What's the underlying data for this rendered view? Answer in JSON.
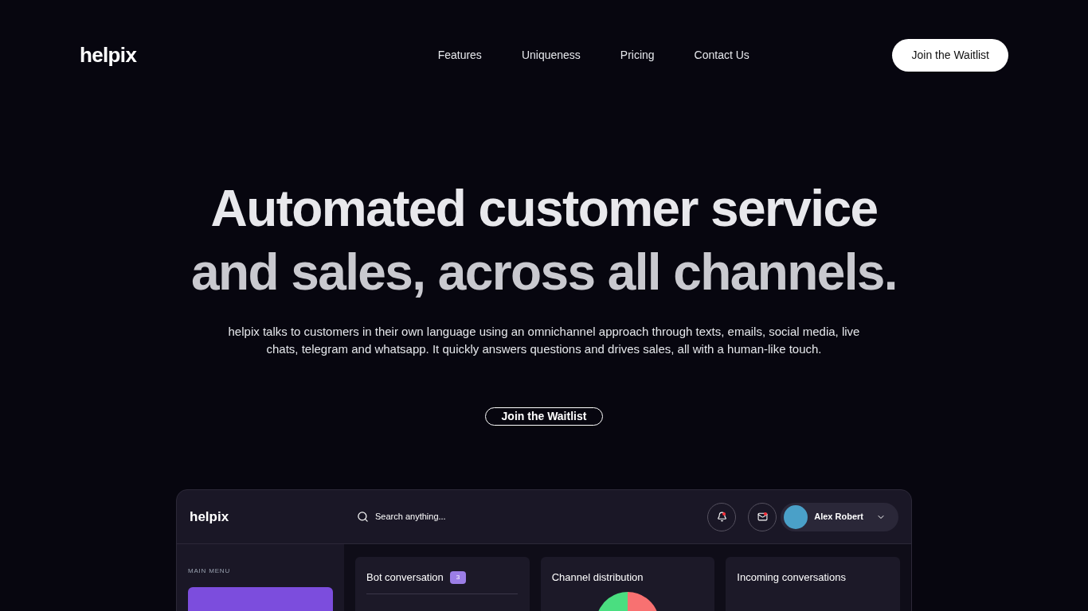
{
  "brand": "helpix",
  "nav": [
    {
      "label": "Features"
    },
    {
      "label": "Uniqueness"
    },
    {
      "label": "Pricing"
    },
    {
      "label": "Contact Us"
    }
  ],
  "nav_button": "Join the Waitlist",
  "hero": {
    "headline_lines": [
      "Automated customer service",
      "and sales, across all channels."
    ],
    "description": "helpix talks to customers in their own language using an omnichannel approach through texts, emails, social media, live chats, telegram and whatsapp. It quickly answers questions and drives sales, all with a human-like touch.",
    "button": "Join the Waitlist"
  },
  "dashboard": {
    "brand": "helpix",
    "search": {
      "placeholder": "Search anything..."
    },
    "user": "Alex Robert",
    "sidebar": {
      "section": "MAIN MENU"
    },
    "cards": [
      {
        "title": "Bot conversation",
        "badge": "3",
        "kind": "list"
      },
      {
        "title": "Channel distribution",
        "kind": "pie"
      },
      {
        "title": "Incoming conversations",
        "kind": "plain"
      }
    ]
  }
}
